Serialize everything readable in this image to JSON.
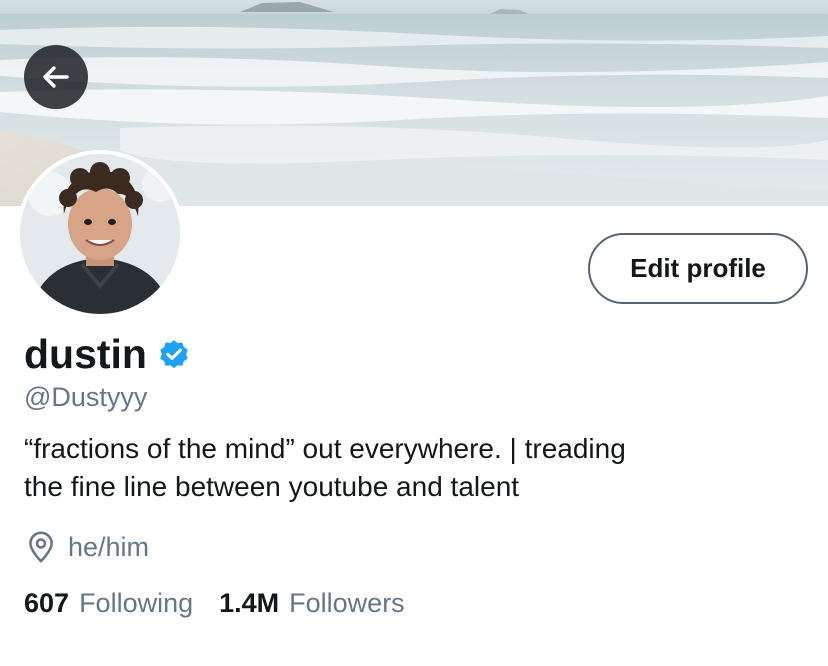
{
  "header": {
    "back_icon": "arrow-left-icon"
  },
  "profile": {
    "display_name": "dustin",
    "verified_icon": "verified-badge-icon",
    "handle": "@Dustyyy",
    "bio_lines": [
      "“fractions of the mind” out everywhere. | treading",
      "the fine line between youtube and talent"
    ],
    "location_icon": "location-pin-icon",
    "location": "he/him",
    "edit_profile_label": "Edit profile"
  },
  "stats": {
    "following_count": "607",
    "following_label": "Following",
    "followers_count": "1.4M",
    "followers_label": "Followers"
  },
  "colors": {
    "accent": "#1da1f2",
    "secondary_text": "#657786",
    "primary_text": "#14171a"
  }
}
